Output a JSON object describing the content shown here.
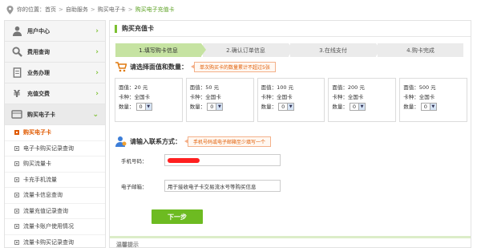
{
  "breadcrumb": {
    "prefix": "你的位置：",
    "items": [
      "首页",
      "自助服务",
      "购买电子卡",
      "购买电子充值卡"
    ],
    "separator": ">"
  },
  "sidebar": {
    "items": [
      {
        "label": "用户中心",
        "icon": "user-icon"
      },
      {
        "label": "费用查询",
        "icon": "search-icon"
      },
      {
        "label": "业务办理",
        "icon": "document-icon"
      },
      {
        "label": "充值交费",
        "icon": "yen-icon"
      },
      {
        "label": "购买电子卡",
        "icon": "card-icon",
        "expanded": true
      }
    ],
    "sub_items": [
      {
        "label": "购买电子卡",
        "active": true
      },
      {
        "label": "电子卡购买记录查询"
      },
      {
        "label": "购买流量卡"
      },
      {
        "label": "卡充手机流量"
      },
      {
        "label": "流量卡信息查询"
      },
      {
        "label": "流量充值记录查询"
      },
      {
        "label": "流量卡账户使用情况"
      },
      {
        "label": "流量卡购买记录查询"
      }
    ]
  },
  "main": {
    "title": "购买充值卡",
    "steps": [
      "1.填写购卡信息",
      "2.确认订单信息",
      "3.在线支付",
      "4.购卡完成"
    ],
    "section1": {
      "label": "请选择面值和数量：",
      "tip": "单次购买卡的数量累计不超过5张"
    },
    "cards": [
      {
        "face_label": "面值：",
        "face": "20 元",
        "type_label": "卡种：",
        "type": "全国卡",
        "qty_label": "数量：",
        "qty": "0"
      },
      {
        "face_label": "面值：",
        "face": "50 元",
        "type_label": "卡种：",
        "type": "全国卡",
        "qty_label": "数量：",
        "qty": "0"
      },
      {
        "face_label": "面值：",
        "face": "100 元",
        "type_label": "卡种：",
        "type": "全国卡",
        "qty_label": "数量：",
        "qty": "0"
      },
      {
        "face_label": "面值：",
        "face": "200 元",
        "type_label": "卡种：",
        "type": "全国卡",
        "qty_label": "数量：",
        "qty": "0"
      },
      {
        "face_label": "面值：",
        "face": "500 元",
        "type_label": "卡种：",
        "type": "全国卡",
        "qty_label": "数量：",
        "qty": "0"
      }
    ],
    "section2": {
      "label": "请输入联系方式：",
      "tip": "手机号码或电子邮箱至少填写一个"
    },
    "phone": {
      "label": "手机号码：",
      "value": ""
    },
    "email": {
      "label": "电子邮箱：",
      "placeholder": "用于接收电子卡交易流水号等购买信息"
    },
    "next_label": "下一步",
    "warm_tips": "温馨提示"
  },
  "colors": {
    "accent": "#6dbb21",
    "active_orange": "#e05a00",
    "step_active": "#c6e3a2"
  }
}
